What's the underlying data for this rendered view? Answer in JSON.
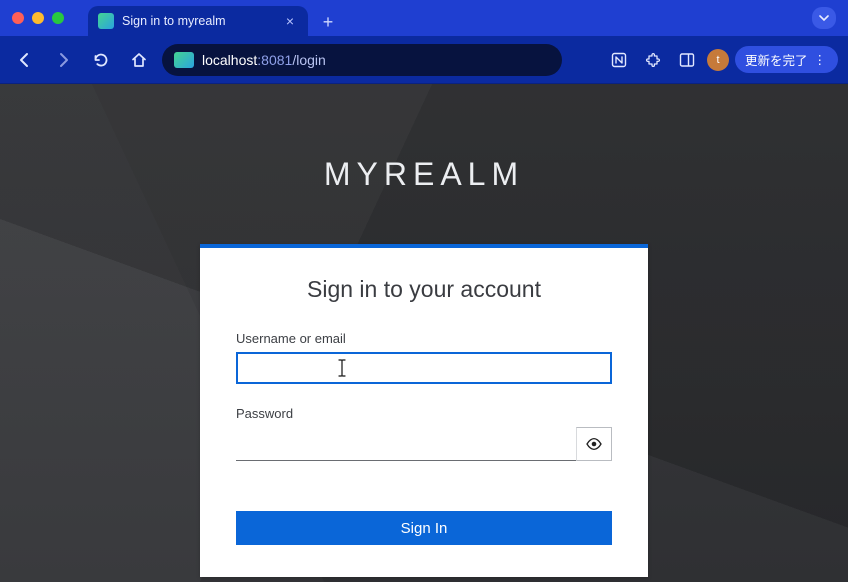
{
  "browser": {
    "tab": {
      "title": "Sign in to myrealm"
    },
    "url": {
      "host": "localhost",
      "port": ":8081",
      "path": "/login"
    },
    "update_label": "更新を完了",
    "avatar_letter": "t"
  },
  "page": {
    "realm_title": "MYREALM",
    "card_heading": "Sign in to your account",
    "username": {
      "label": "Username or email",
      "value": ""
    },
    "password": {
      "label": "Password",
      "value": ""
    },
    "submit_label": "Sign In"
  }
}
